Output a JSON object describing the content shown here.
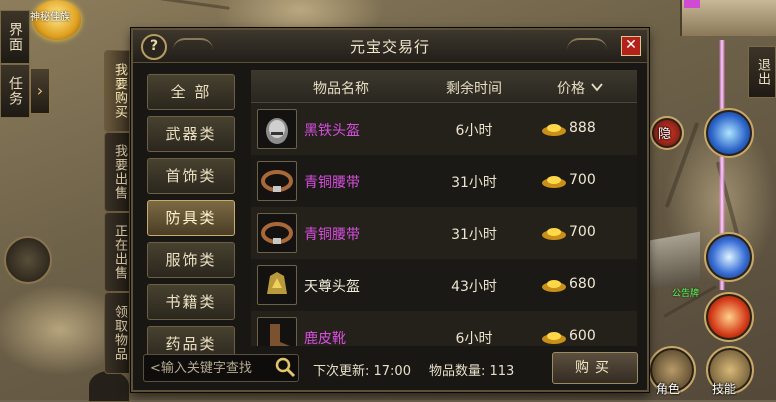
{
  "hud": {
    "left_buttons": [
      "界面",
      "任务"
    ],
    "orb_label": "神秘佳族",
    "vertical_tabs": [
      "我要购买",
      "我要出售",
      "正在出售",
      "领取物品"
    ],
    "right_buttons": {
      "exit": "退出",
      "hide": "隐",
      "role": "角色",
      "skill": "技能"
    },
    "map_label": "公告牌"
  },
  "dialog": {
    "title": "元宝交易行",
    "help_label": "?",
    "close_label": "✕",
    "categories": [
      {
        "label": "全 部"
      },
      {
        "label": "武器类"
      },
      {
        "label": "首饰类"
      },
      {
        "label": "防具类"
      },
      {
        "label": "服饰类"
      },
      {
        "label": "书籍类"
      },
      {
        "label": "药品类"
      }
    ],
    "selected_category": "防具类",
    "columns": {
      "name": "物品名称",
      "time": "剩余时间",
      "price": "价格"
    },
    "items": [
      {
        "name": "黑铁头盔",
        "time": "6小时",
        "price": "888",
        "name_color": "#d84ee0",
        "icon": "helmet-icon"
      },
      {
        "name": "青铜腰带",
        "time": "31小时",
        "price": "700",
        "name_color": "#d84ee0",
        "icon": "belt-icon"
      },
      {
        "name": "青铜腰带",
        "time": "31小时",
        "price": "700",
        "name_color": "#d84ee0",
        "icon": "belt-icon"
      },
      {
        "name": "天尊头盔",
        "time": "43小时",
        "price": "680",
        "name_color": "#f0ead8",
        "icon": "helmet-icon"
      },
      {
        "name": "鹿皮靴",
        "time": "6小时",
        "price": "600",
        "name_color": "#d84ee0",
        "icon": "boot-icon"
      }
    ],
    "search_placeholder": "<输入关键字查找",
    "next_update": "下次更新: 17:00",
    "item_count": "物品数量: 113",
    "buy_label": "购买"
  }
}
